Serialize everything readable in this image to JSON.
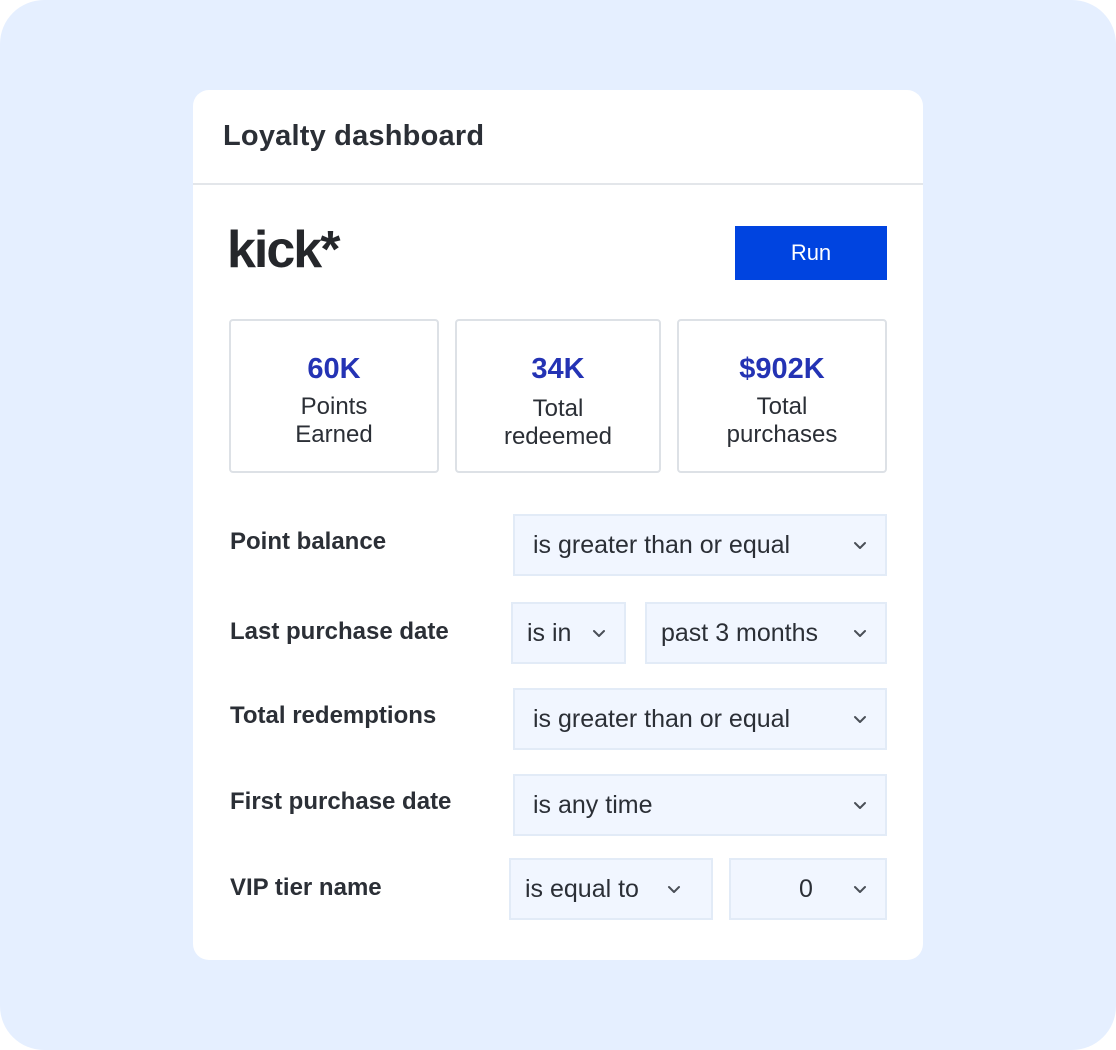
{
  "card": {
    "title": "Loyalty dashboard",
    "logo": "kick*",
    "run_label": "Run"
  },
  "stats": [
    {
      "value": "60K",
      "label_line1": "Points",
      "label_line2": "Earned"
    },
    {
      "value": "34K",
      "label_line1": "Total",
      "label_line2": "redeemed"
    },
    {
      "value": "$902K",
      "label_line1": "Total",
      "label_line2": "purchases"
    }
  ],
  "filters": {
    "point_balance": {
      "label": "Point balance",
      "operator": "is greater than or equal"
    },
    "last_purchase_date": {
      "label": "Last purchase date",
      "operator": "is in",
      "value": "past 3 months"
    },
    "total_redemptions": {
      "label": "Total redemptions",
      "operator": "is greater than or equal"
    },
    "first_purchase_date": {
      "label": "First purchase date",
      "operator": "is any time"
    },
    "vip_tier_name": {
      "label": "VIP tier name",
      "operator": "is equal to",
      "value": "0"
    }
  },
  "icons": {
    "dropdown": "chevron-down-icon"
  },
  "colors": {
    "background": "#e5efff",
    "accent": "#0044e0",
    "stat_value": "#2433b4",
    "select_fill": "#f1f6ff"
  }
}
